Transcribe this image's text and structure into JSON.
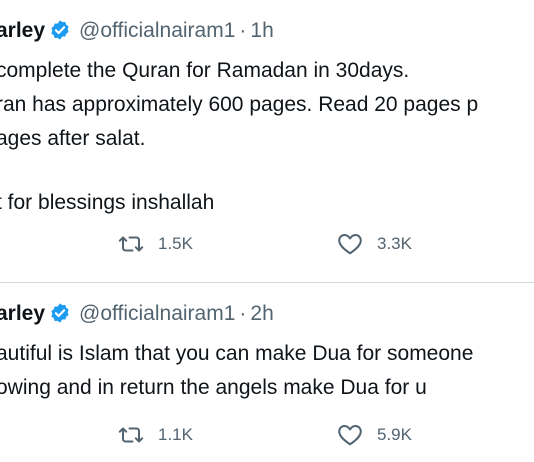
{
  "tweets": [
    {
      "author": "arley",
      "handle": "@officialnairam1",
      "separator": "·",
      "time": "1h",
      "lines": [
        "complete the Quran for Ramadan in 30days.",
        "ran has approximately 600 pages. Read 20 pages p",
        "ages after salat.",
        "",
        "t for blessings inshallah"
      ],
      "retweets": "1.5K",
      "likes": "3.3K"
    },
    {
      "author": "arley",
      "handle": "@officialnairam1",
      "separator": "·",
      "time": "2h",
      "lines": [
        "autiful is Islam that you can make Dua for someone",
        "owing and in return the angels make Dua for u"
      ],
      "retweets": "1.1K",
      "likes": "5.9K"
    }
  ],
  "colors": {
    "text": "#0f1419",
    "secondary": "#536471",
    "verified": "#1d9bf0",
    "divider": "#cfd9de"
  },
  "icons": {
    "verified": "verified-badge-icon",
    "retweet": "retweet-icon",
    "like": "heart-icon"
  }
}
